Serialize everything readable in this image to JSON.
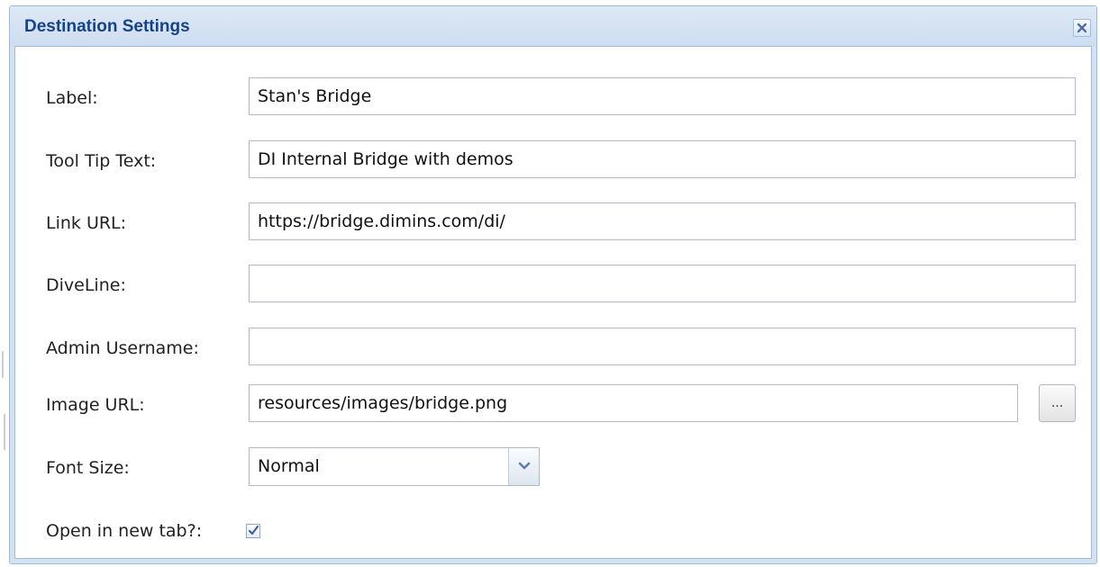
{
  "dialog": {
    "title": "Destination Settings",
    "close_icon": "close-icon"
  },
  "form": {
    "label": {
      "label": "Label:",
      "value": "Stan's Bridge"
    },
    "tooltip": {
      "label": "Tool Tip Text:",
      "value": "DI Internal Bridge with demos"
    },
    "link_url": {
      "label": "Link URL:",
      "value": "https://bridge.dimins.com/di/"
    },
    "diveline": {
      "label": "DiveLine:",
      "value": ""
    },
    "admin_username": {
      "label": "Admin Username:",
      "value": ""
    },
    "image_url": {
      "label": "Image URL:",
      "value": "resources/images/bridge.png",
      "browse_label": "..."
    },
    "font_size": {
      "label": "Font Size:",
      "selected": "Normal",
      "trigger_icon": "chevron-down-icon"
    },
    "open_new_tab": {
      "label": "Open in new tab?:",
      "checked": true
    }
  },
  "colors": {
    "title_text": "#15428b",
    "header_bg": "#d3e1f1",
    "border": "#99bbe8",
    "field_border": "#b5b8c8",
    "checkmark": "#3e5ea8"
  }
}
